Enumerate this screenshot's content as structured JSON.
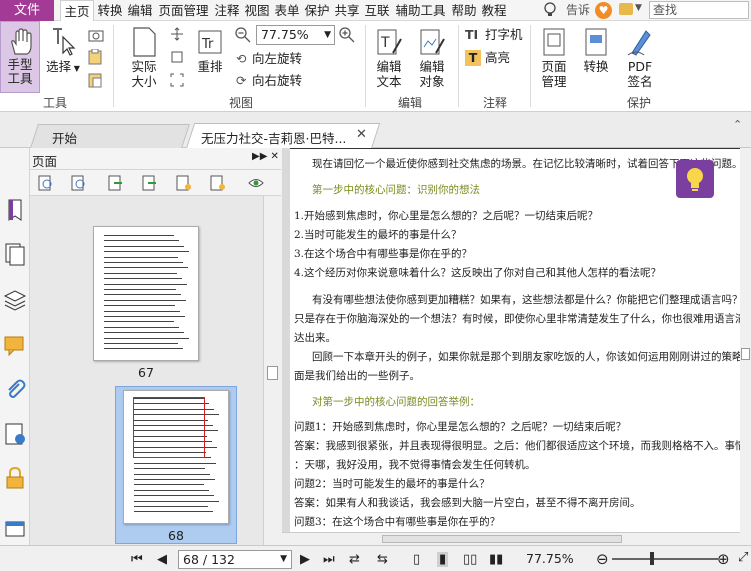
{
  "menubar": {
    "file": "文件",
    "items": [
      "主页",
      "转换",
      "编辑",
      "页面管理",
      "注释",
      "视图",
      "表单",
      "保护",
      "共享",
      "互联",
      "辅助工具",
      "帮助",
      "教程"
    ],
    "active_index": 0,
    "notify_text": "告诉",
    "search_placeholder": "查找",
    "colors": {
      "file_bg": "#a33a96",
      "badge": "#f08d28"
    }
  },
  "ribbon": {
    "hand_tool": "手型\n工具",
    "select": "选择",
    "actual_size": "实际\n大小",
    "reflow": "重排",
    "zoom_value": "77.75%",
    "rotate_left": "向左旋转",
    "rotate_right": "向右旋转",
    "edit_text": "编辑\n文本",
    "edit_object": "编辑\n对象",
    "typewriter": "打字机",
    "highlight": "高亮",
    "page_manage": "页面\n管理",
    "convert": "转换",
    "pdf_sign": "PDF\n签名",
    "groups": {
      "tools": "工具",
      "view": "视图",
      "edit": "编辑",
      "comment": "注释",
      "protect": "保护"
    }
  },
  "tabs": {
    "start": "开始",
    "doc": "无压力社交-吉莉恩·巴特..."
  },
  "pages_panel": {
    "title": "页面",
    "thumbs": [
      {
        "label": "67"
      },
      {
        "label": "68"
      }
    ]
  },
  "document": {
    "lines": [
      {
        "text": "现在请回忆一个最近使你感到社交焦虑的场景。在记忆比较清晰时，试着回答下面这些问题。",
        "type": "body",
        "indent": true
      },
      {
        "text": "第一步中的核心问题：识别你的想法",
        "type": "heading",
        "indent": true
      },
      {
        "text": "1.开始感到焦虑时，你心里是怎么想的？之后呢？一切结束后呢？",
        "type": "body",
        "indent": false
      },
      {
        "text": "2.当时可能发生的最坏的事是什么？",
        "type": "body",
        "indent": false
      },
      {
        "text": "3.在这个场合中有哪些事是你在乎的？",
        "type": "body",
        "indent": false
      },
      {
        "text": "4.这个经历对你来说意味着什么？这反映出了你对自己和其他人怎样的看法呢？",
        "type": "body",
        "indent": false
      },
      {
        "text": "有没有哪些想法使你感到更加糟糕？如果有，这些想法都是什么？你能把它们整理成语言吗？",
        "type": "body",
        "indent": true
      },
      {
        "text": "只是存在于你脑海深处的一个想法？有时候，即使你心里非常清楚发生了什么，你也很难用语言清",
        "type": "body",
        "indent": false
      },
      {
        "text": "达出来。",
        "type": "body",
        "indent": false
      },
      {
        "text": "回顾一下本章开头的例子，如果你就是那个到朋友家吃饭的人，你该如何运用刚刚讲过的策略",
        "type": "body",
        "indent": true
      },
      {
        "text": "面是我们给出的一些例子。",
        "type": "body",
        "indent": false
      },
      {
        "text": "对第一步中的核心问题的回答举例：",
        "type": "heading",
        "indent": true
      },
      {
        "text": "问题1：开始感到焦虑时，你心里是怎么想的？之后呢？一切结束后呢？",
        "type": "body",
        "indent": false
      },
      {
        "text": "答案：我感到很紧张，并且表现得很明显。之后：他们都很适应这个环境，而我则格格不入。事情",
        "type": "body",
        "indent": false
      },
      {
        "text": "：天哪，我好没用，我不觉得事情会发生任何转机。",
        "type": "body",
        "indent": false
      },
      {
        "text": "问题2：当时可能发生的最坏的事是什么？",
        "type": "body",
        "indent": false
      },
      {
        "text": "答案：如果有人和我谈话，我会感到大脑一片空白，甚至不得不离开房间。",
        "type": "body",
        "indent": false
      },
      {
        "text": "问题3：在这个场合中有哪些事是你在乎的？",
        "type": "body",
        "indent": false
      }
    ]
  },
  "statusbar": {
    "page_value": "68 / 132",
    "zoom": "77.75%",
    "zoom_level_percent": 38
  }
}
